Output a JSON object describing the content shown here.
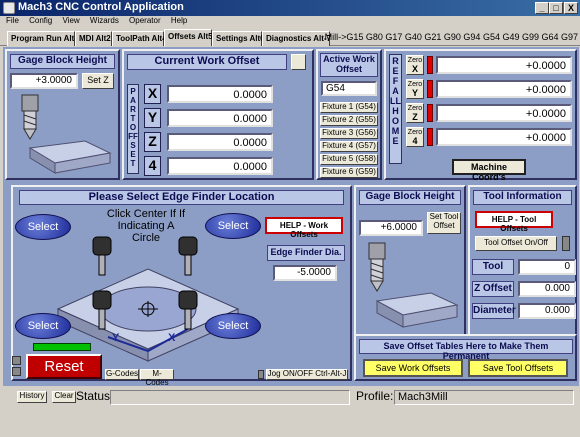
{
  "window": {
    "title": "Mach3 CNC Control Application",
    "min": "_",
    "max": "□",
    "close": "X"
  },
  "menu": [
    "File",
    "Config",
    "View",
    "Wizards",
    "Operator",
    "Help"
  ],
  "tabs": [
    "Program Run Alt-1",
    "MDI Alt2",
    "ToolPath Alt4",
    "Offsets Alt5",
    "Settings Alt6",
    "Diagnostics Alt-7"
  ],
  "gcodes": "Mill->G15  G80 G17 G40 G21 G90 G94 G54 G49 G99 G64 G97",
  "gage_block_left": {
    "title": "Gage Block Height",
    "value": "+3.0000",
    "set_z": "Set Z"
  },
  "current_offset": {
    "title": "Current Work Offset",
    "part_offset_label": "PART OFFSET",
    "axes": [
      {
        "label": "X",
        "value": "0.0000"
      },
      {
        "label": "Y",
        "value": "0.0000"
      },
      {
        "label": "Z",
        "value": "0.0000"
      },
      {
        "label": "4",
        "value": "0.0000"
      }
    ]
  },
  "active_work_offset": {
    "title": "Active Work Offset",
    "value": "G54",
    "fixtures": [
      "Fixture 1 (G54)",
      "Fixture 2 (G55)",
      "Fixture 3 (G56)",
      "Fixture 4 (G57)",
      "Fixture 5 (G58)",
      "Fixture 6 (G59)"
    ]
  },
  "ref_all_home": {
    "label": "REF ALL HOME",
    "zero_label": "Zero",
    "axes": [
      {
        "label": "X",
        "value": "+0.0000"
      },
      {
        "label": "Y",
        "value": "+0.0000"
      },
      {
        "label": "Z",
        "value": "+0.0000"
      },
      {
        "label": "4",
        "value": "+0.0000"
      }
    ],
    "machine_coords": "Machine Coord's"
  },
  "edge_finder": {
    "title": "Please Select Edge Finder Location",
    "instructions": "Click Center If If Indicating A Circle",
    "select": "Select",
    "help_button": "HELP - Work Offsets",
    "dia_label": "Edge Finder Dia.",
    "dia_value": "-5.0000",
    "axis_y": "Y",
    "axis_x": "X"
  },
  "gage_block_right": {
    "title": "Gage Block Height",
    "value": "+6.0000",
    "set_tool_offset": "Set Tool Offset"
  },
  "tool_info": {
    "title": "Tool Information",
    "help_button": "HELP - Tool Offsets",
    "on_off": "Tool Offset On/Off",
    "tool_label": "Tool",
    "tool_value": "0",
    "z_offset_label": "Z Offset",
    "z_offset_value": "0.000",
    "diameter_label": "Diameter",
    "diameter_value": "0.000"
  },
  "save_tables": {
    "title": "Save Offset Tables Here to Make Them Permanent",
    "save_work": "Save Work Offsets",
    "save_tool": "Save Tool Offsets"
  },
  "bottom": {
    "reset": "Reset",
    "gcodes": "G-Codes",
    "mcodes": "M-Codes",
    "jog": "Jog ON/OFF Ctrl-Alt-J",
    "history": "History",
    "clear": "Clear",
    "status_label": "Status:",
    "status_value": "",
    "profile_label": "Profile:",
    "profile_value": "Mach3Mill"
  }
}
